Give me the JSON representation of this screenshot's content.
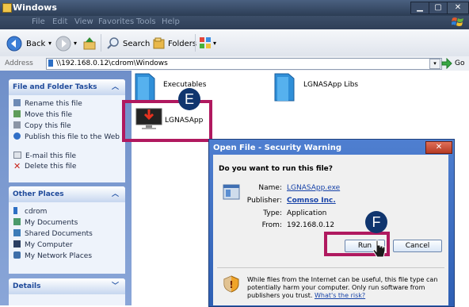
{
  "window": {
    "title": "Windows",
    "min": "▁",
    "max": "▢",
    "close": "✕"
  },
  "menu": [
    "File",
    "Edit",
    "View",
    "Favorites",
    "Tools",
    "Help"
  ],
  "toolbar": {
    "back": "Back",
    "search": "Search",
    "folders": "Folders"
  },
  "address": {
    "label": "Address",
    "value": "\\\\192.168.0.12\\cdrom\\Windows",
    "go": "Go"
  },
  "sidebar": {
    "file_tasks": {
      "title": "File and Folder Tasks",
      "items": [
        "Rename this file",
        "Move this file",
        "Copy this file",
        "Publish this file to the Web",
        "E-mail this file",
        "Delete this file"
      ]
    },
    "other_places": {
      "title": "Other Places",
      "items": [
        "cdrom",
        "My Documents",
        "Shared Documents",
        "My Computer",
        "My Network Places"
      ]
    },
    "details": {
      "title": "Details"
    }
  },
  "files": {
    "executables": "Executables",
    "libs": "LGNASApp Libs",
    "app": "LGNASApp"
  },
  "annotations": {
    "e": "E",
    "f": "F"
  },
  "dialog": {
    "title": "Open File - Security Warning",
    "question": "Do you want to run this file?",
    "name_label": "Name:",
    "name_value": "LGNASApp.exe",
    "publisher_label": "Publisher:",
    "publisher_value": "Comnso Inc.",
    "type_label": "Type:",
    "type_value": "Application",
    "from_label": "From:",
    "from_value": "192.168.0.12",
    "run": "Run",
    "cancel": "Cancel",
    "warning": "While files from the Internet can be useful, this file type can potentially harm your computer. Only run software from publishers you trust.",
    "risk_link": "What's the risk?"
  },
  "colors": {
    "highlight": "#b0195f",
    "badge": "#10356e",
    "sidebar": "#7b98cf"
  }
}
